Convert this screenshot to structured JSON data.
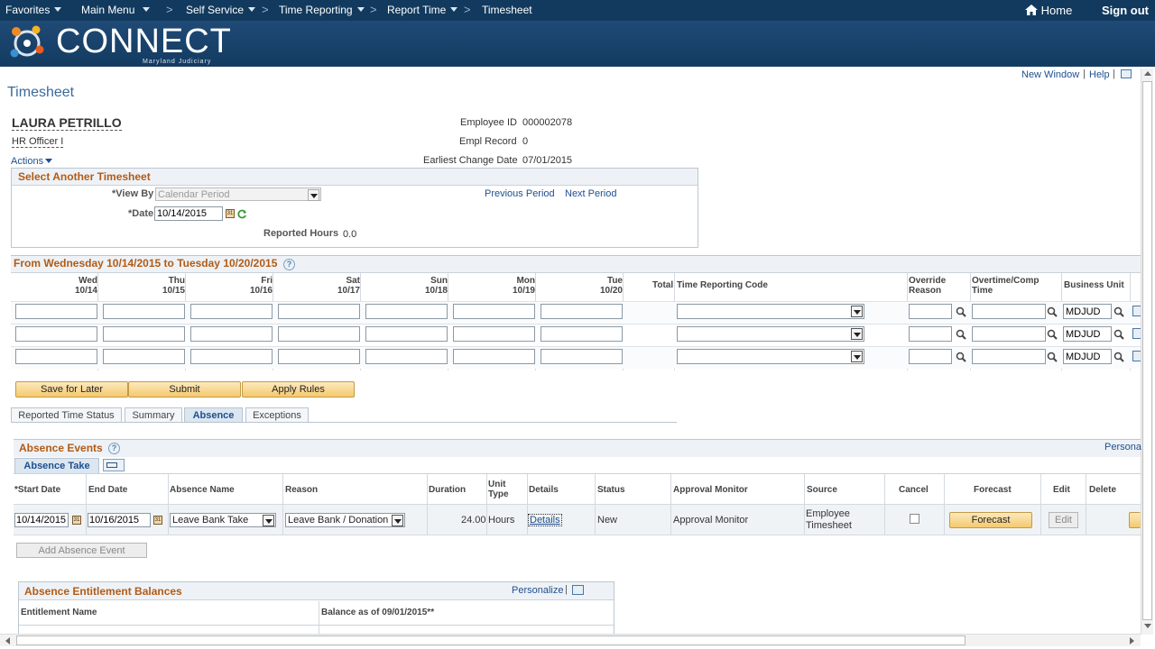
{
  "nav": {
    "favorites": "Favorites",
    "main_menu": "Main Menu",
    "self_service": "Self Service",
    "time_reporting": "Time Reporting",
    "report_time": "Report Time",
    "timesheet": "Timesheet",
    "home": "Home",
    "sign_out": "Sign out"
  },
  "logo": {
    "name": "CONNECT",
    "sub": "Maryland Judiciary"
  },
  "links": {
    "new_window": "New Window",
    "help": "Help"
  },
  "page": {
    "title": "Timesheet"
  },
  "employee": {
    "name": "LAURA PETRILLO",
    "job": "HR Officer I",
    "actions": "Actions",
    "id_label": "Employee ID",
    "id": "000002078",
    "rec_label": "Empl Record",
    "rec": "0",
    "ecd_label": "Earliest Change Date",
    "ecd": "07/01/2015"
  },
  "select": {
    "title": "Select Another Timesheet",
    "view_by_label": "*View By",
    "view_by": "Calendar Period",
    "date_label": "*Date",
    "date": "10/14/2015",
    "prev": "Previous Period",
    "next": "Next Period",
    "rep_label": "Reported Hours",
    "rep": "0.0"
  },
  "period": {
    "title": "From Wednesday 10/14/2015 to Tuesday 10/20/2015",
    "days": [
      {
        "d": "Wed",
        "dt": "10/14"
      },
      {
        "d": "Thu",
        "dt": "10/15"
      },
      {
        "d": "Fri",
        "dt": "10/16"
      },
      {
        "d": "Sat",
        "dt": "10/17"
      },
      {
        "d": "Sun",
        "dt": "10/18"
      },
      {
        "d": "Mon",
        "dt": "10/19"
      },
      {
        "d": "Tue",
        "dt": "10/20"
      }
    ],
    "total": "Total",
    "trc": "Time Reporting Code",
    "override1": "Override",
    "override2": "Reason",
    "ot1": "Overtime/Comp",
    "ot2": "Time",
    "bu": "Business Unit",
    "bu_value": "MDJUD"
  },
  "buttons": {
    "save": "Save for Later",
    "submit": "Submit",
    "apply": "Apply Rules"
  },
  "tabs": [
    "Reported Time Status",
    "Summary",
    "Absence",
    "Exceptions"
  ],
  "absence": {
    "title": "Absence Events",
    "personalize": "Persona",
    "subtab": "Absence Take",
    "cols": {
      "start": "*Start Date",
      "end": "End Date",
      "name": "Absence Name",
      "reason": "Reason",
      "duration": "Duration",
      "unit1": "Unit",
      "unit2": "Type",
      "details": "Details",
      "status": "Status",
      "approval": "Approval Monitor",
      "source": "Source",
      "cancel": "Cancel",
      "forecast": "Forecast",
      "edit": "Edit",
      "delete": "Delete"
    },
    "row": {
      "start": "10/14/2015",
      "end": "10/16/2015",
      "name": "Leave Bank Take",
      "reason": "Leave Bank / Donation",
      "duration": "24.00",
      "unit": "Hours",
      "details": "Details",
      "status": "New",
      "approval": "Approval Monitor",
      "source1": "Employee",
      "source2": "Timesheet",
      "forecast": "Forecast",
      "edit": "Edit"
    },
    "add": "Add Absence Event"
  },
  "balances": {
    "title": "Absence Entitlement Balances",
    "personalize": "Personalize",
    "col1": "Entitlement Name",
    "col2": "Balance as of 09/01/2015**"
  }
}
